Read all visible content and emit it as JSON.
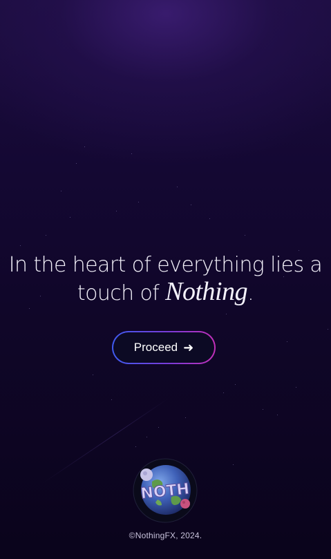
{
  "headline": {
    "line1": "In the heart of everything lies a",
    "line2_prefix": "touch of ",
    "line2_brand": "Nothing",
    "line2_suffix": "."
  },
  "cta": {
    "label": "Proceed",
    "icon": "arrow-right-icon",
    "arrow_glyph": "➜",
    "gradient_colors": [
      "#3f5bf0",
      "#7a3bd8",
      "#c22fb8"
    ]
  },
  "logo": {
    "name": "nothing-planet-logo",
    "text": "NOTH"
  },
  "footer": {
    "copyright": "©NothingFX, 2024."
  },
  "colors": {
    "background_top": "#1c0d3f",
    "background_bottom": "#0a041b",
    "text": "#f4f2fb"
  }
}
